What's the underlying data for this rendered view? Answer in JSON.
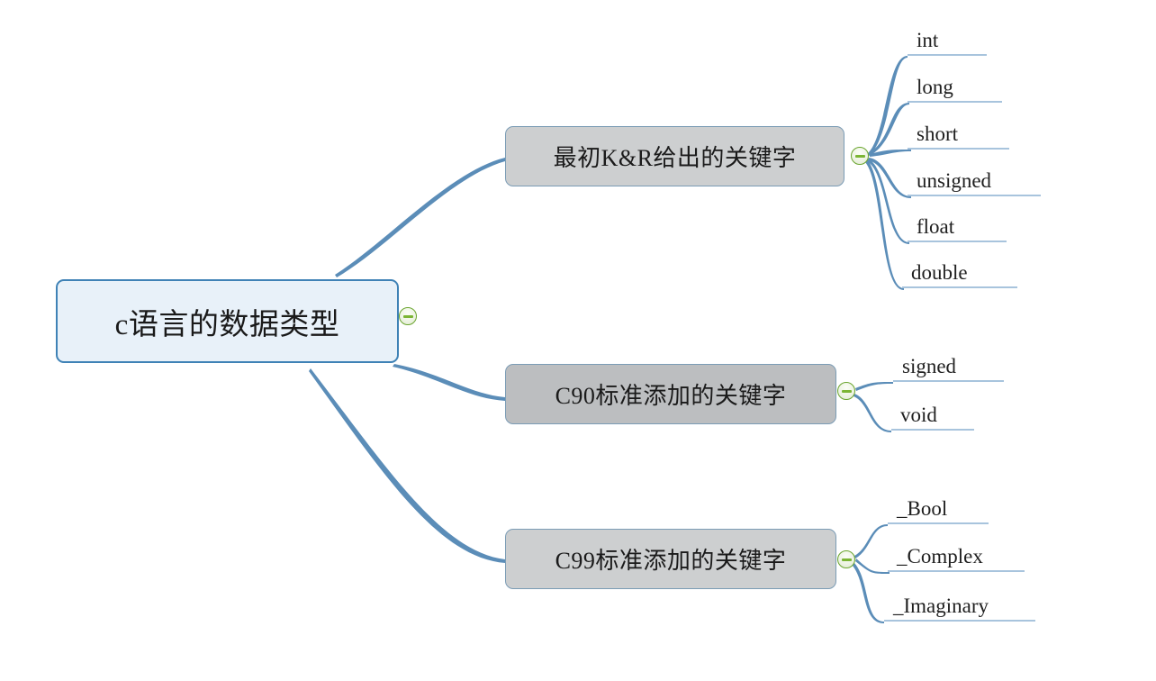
{
  "document": {
    "type": "mind-map",
    "title": "c语言的数据类型"
  },
  "colors": {
    "root_fill": "#e8f1f9",
    "root_border": "#3f82b6",
    "branch_fill_light": "#cdcfd0",
    "branch_fill_dark": "#bcbec0",
    "branch_border": "#7b9cb5",
    "edge": "#5b8db8",
    "leaf_underline": "#a8c4dd",
    "toggle_border": "#6aa52e",
    "toggle_minus": "#7bb534",
    "text": "#1a1a1a",
    "background": "#ffffff"
  },
  "root": {
    "label": "c语言的数据类型",
    "toggle_state": "expanded",
    "toggle_symbol": "−"
  },
  "branches": [
    {
      "id": "kr",
      "label": "最初K&R给出的关键字",
      "fill": "#cdcfd0",
      "toggle_state": "expanded",
      "leaves": [
        {
          "label": "int"
        },
        {
          "label": "long"
        },
        {
          "label": "short"
        },
        {
          "label": "unsigned"
        },
        {
          "label": "float"
        },
        {
          "label": "double"
        }
      ]
    },
    {
      "id": "c90",
      "label": "C90标准添加的关键字",
      "fill": "#bcbec0",
      "toggle_state": "expanded",
      "leaves": [
        {
          "label": "signed"
        },
        {
          "label": "void"
        }
      ]
    },
    {
      "id": "c99",
      "label": "C99标准添加的关键字",
      "fill": "#cdcfd0",
      "toggle_state": "expanded",
      "leaves": [
        {
          "label": "_Bool"
        },
        {
          "label": "_Complex"
        },
        {
          "label": "_Imaginary"
        }
      ]
    }
  ]
}
